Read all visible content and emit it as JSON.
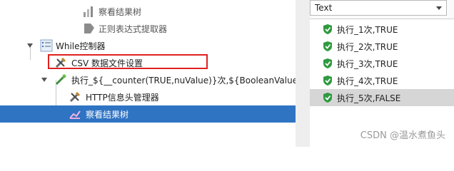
{
  "tree": {
    "items": [
      {
        "label": "察看结果树",
        "icon": "report-icon"
      },
      {
        "label": "正则表达式提取器",
        "icon": "extractor-icon"
      },
      {
        "label": "While控制器",
        "icon": "controller-icon"
      },
      {
        "label": "CSV 数据文件设置",
        "icon": "wrench-icon"
      },
      {
        "label": "执行_${__counter(TRUE,nuValue)}次,${BooleanValue}",
        "icon": "sampler-icon"
      },
      {
        "label": "HTTP信息头管理器",
        "icon": "wrench-icon"
      },
      {
        "label": "察看结果树",
        "icon": "report-icon"
      }
    ]
  },
  "results": {
    "renderer": "Text",
    "items": [
      {
        "label": "执行_1次,TRUE",
        "icon": "check-shield-icon"
      },
      {
        "label": "执行_2次,TRUE",
        "icon": "check-shield-icon"
      },
      {
        "label": "执行_3次,TRUE",
        "icon": "check-shield-icon"
      },
      {
        "label": "执行_4次,TRUE",
        "icon": "check-shield-icon"
      },
      {
        "label": "执行_5次,FALSE",
        "icon": "check-shield-icon"
      }
    ]
  },
  "watermark": "CSDN @温水煮鱼头",
  "colors": {
    "selection": "#2f73c3",
    "highlight_box": "#e02020",
    "check": "#2f9a3f"
  }
}
